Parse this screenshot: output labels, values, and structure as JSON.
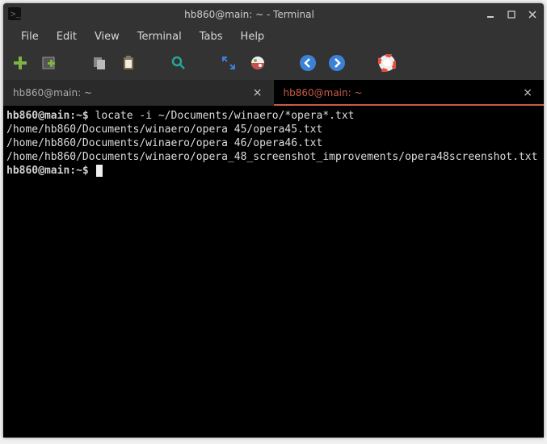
{
  "window": {
    "title": "hb860@main: ~ - Terminal"
  },
  "menu": {
    "file": "File",
    "edit": "Edit",
    "view": "View",
    "terminal": "Terminal",
    "tabs": "Tabs",
    "help": "Help"
  },
  "tabs": {
    "inactive": {
      "label": "hb860@main: ~"
    },
    "active": {
      "label": "hb860@main: ~"
    }
  },
  "terminal": {
    "prompt1": "hb860@main:~$ ",
    "cmd1": "locate -i ~/Documents/winaero/*opera*.txt",
    "out1": "/home/hb860/Documents/winaero/opera 45/opera45.txt",
    "out2": "/home/hb860/Documents/winaero/opera 46/opera46.txt",
    "out3": "/home/hb860/Documents/winaero/opera_48_screenshot_improvements/opera48screenshot.txt",
    "prompt2": "hb860@main:~$ "
  }
}
